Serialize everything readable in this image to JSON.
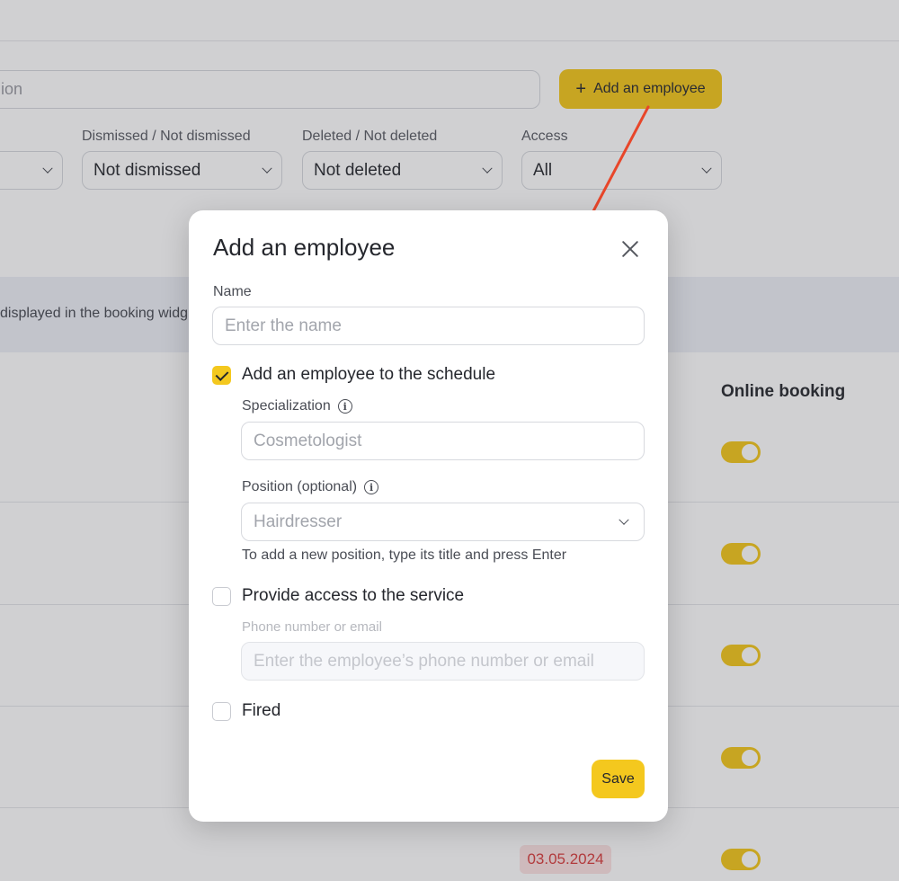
{
  "background": {
    "search_placeholder_fragment": "ion",
    "add_button_label": "Add an employee",
    "filters": [
      {
        "label": "",
        "value": ""
      },
      {
        "label": "Dismissed / Not dismissed",
        "value": "Not dismissed"
      },
      {
        "label": "Deleted / Not deleted",
        "value": "Not deleted"
      },
      {
        "label": "Access",
        "value": "All"
      }
    ],
    "info_text": "displayed in the booking widg",
    "column_header": "Online booking",
    "toggles": [
      true,
      true,
      true,
      true,
      true
    ],
    "date_badge": "03.05.2024"
  },
  "modal": {
    "title": "Add an employee",
    "name_label": "Name",
    "name_placeholder": "Enter the name",
    "schedule_checkbox": {
      "label": "Add an employee to the schedule",
      "checked": true
    },
    "specialization_label": "Specialization",
    "specialization_placeholder": "Cosmetologist",
    "position_label": "Position (optional)",
    "position_placeholder": "Hairdresser",
    "position_hint": "To add a new position, type its title and press Enter",
    "access_checkbox": {
      "label": "Provide access to the service",
      "checked": false
    },
    "contact_label": "Phone number or email",
    "contact_placeholder": "Enter the employee’s phone number or email",
    "fired_checkbox": {
      "label": "Fired",
      "checked": false
    },
    "save_label": "Save"
  },
  "colors": {
    "accent": "#f4c81e",
    "arrow": "#e8462a",
    "overlay": "rgba(40,42,52,0.22)",
    "date_badge_bg": "#fde3e3",
    "date_badge_text": "#d94040"
  }
}
